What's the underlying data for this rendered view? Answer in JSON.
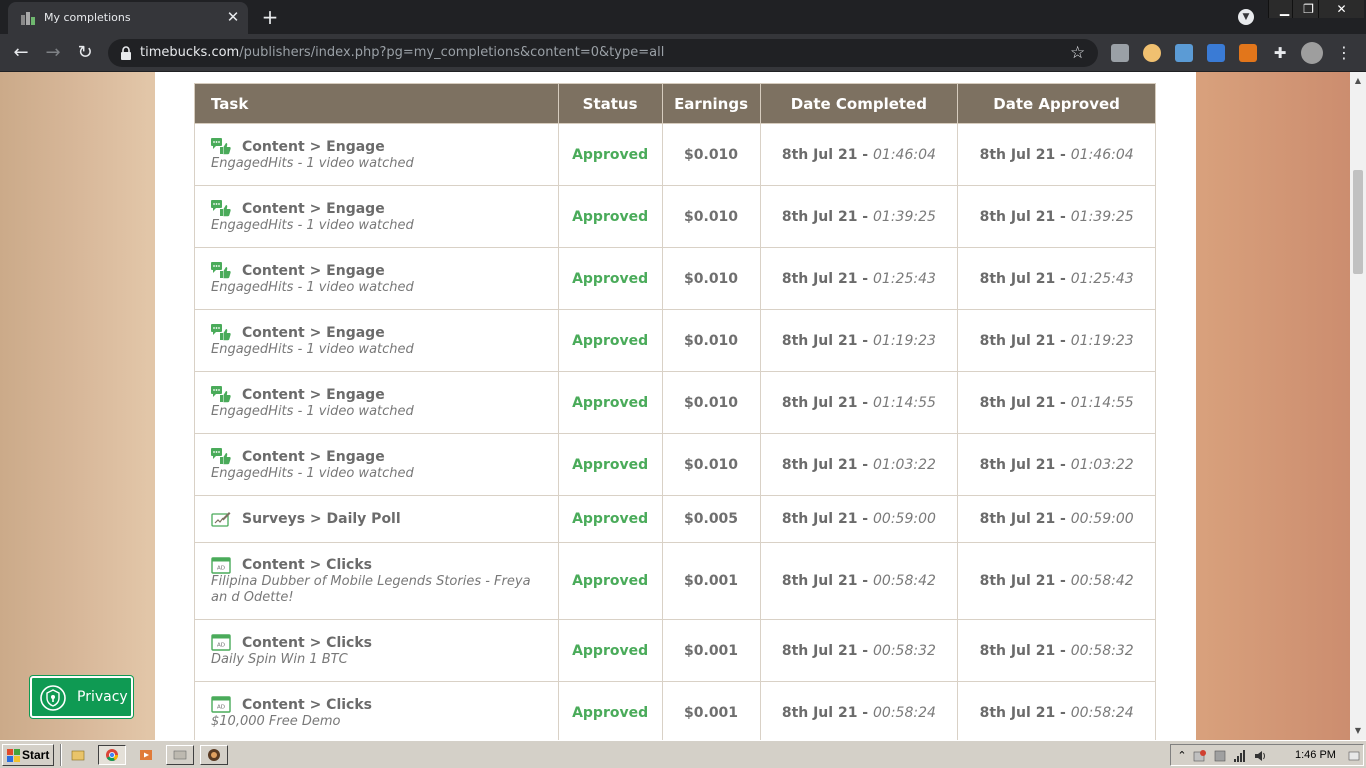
{
  "browser": {
    "tab_title": "My completions",
    "tab_close": "✕",
    "new_tab": "+",
    "url_host": "timebucks.com",
    "url_path": "/publishers/index.php?pg=my_completions&content=0&type=all"
  },
  "table": {
    "headers": {
      "task": "Task",
      "status": "Status",
      "earnings": "Earnings",
      "date_completed": "Date Completed",
      "date_approved": "Date Approved"
    },
    "rows": [
      {
        "icon": "engage-icon",
        "title": "Content > Engage",
        "subtitle": "EngagedHits - 1 video watched",
        "status": "Approved",
        "earnings": "$0.010",
        "completed_date": "8th Jul 21 - ",
        "completed_time": "01:46:04",
        "approved_date": "8th Jul 21 - ",
        "approved_time": "01:46:04"
      },
      {
        "icon": "engage-icon",
        "title": "Content > Engage",
        "subtitle": "EngagedHits - 1 video watched",
        "status": "Approved",
        "earnings": "$0.010",
        "completed_date": "8th Jul 21 - ",
        "completed_time": "01:39:25",
        "approved_date": "8th Jul 21 - ",
        "approved_time": "01:39:25"
      },
      {
        "icon": "engage-icon",
        "title": "Content > Engage",
        "subtitle": "EngagedHits - 1 video watched",
        "status": "Approved",
        "earnings": "$0.010",
        "completed_date": "8th Jul 21 - ",
        "completed_time": "01:25:43",
        "approved_date": "8th Jul 21 - ",
        "approved_time": "01:25:43"
      },
      {
        "icon": "engage-icon",
        "title": "Content > Engage",
        "subtitle": "EngagedHits - 1 video watched",
        "status": "Approved",
        "earnings": "$0.010",
        "completed_date": "8th Jul 21 - ",
        "completed_time": "01:19:23",
        "approved_date": "8th Jul 21 - ",
        "approved_time": "01:19:23"
      },
      {
        "icon": "engage-icon",
        "title": "Content > Engage",
        "subtitle": "EngagedHits - 1 video watched",
        "status": "Approved",
        "earnings": "$0.010",
        "completed_date": "8th Jul 21 - ",
        "completed_time": "01:14:55",
        "approved_date": "8th Jul 21 - ",
        "approved_time": "01:14:55"
      },
      {
        "icon": "engage-icon",
        "title": "Content > Engage",
        "subtitle": "EngagedHits - 1 video watched",
        "status": "Approved",
        "earnings": "$0.010",
        "completed_date": "8th Jul 21 - ",
        "completed_time": "01:03:22",
        "approved_date": "8th Jul 21 - ",
        "approved_time": "01:03:22"
      },
      {
        "icon": "poll-icon",
        "title": "Surveys > Daily Poll",
        "subtitle": "",
        "status": "Approved",
        "earnings": "$0.005",
        "completed_date": "8th Jul 21 - ",
        "completed_time": "00:59:00",
        "approved_date": "8th Jul 21 - ",
        "approved_time": "00:59:00"
      },
      {
        "icon": "ad-clicks-icon",
        "title": "Content > Clicks",
        "subtitle": "Filipina Dubber of Mobile Legends Stories - Freya an d Odette!",
        "status": "Approved",
        "earnings": "$0.001",
        "completed_date": "8th Jul 21 - ",
        "completed_time": "00:58:42",
        "approved_date": "8th Jul 21 - ",
        "approved_time": "00:58:42"
      },
      {
        "icon": "ad-clicks-icon",
        "title": "Content > Clicks",
        "subtitle": "Daily Spin Win 1 BTC",
        "status": "Approved",
        "earnings": "$0.001",
        "completed_date": "8th Jul 21 - ",
        "completed_time": "00:58:32",
        "approved_date": "8th Jul 21 - ",
        "approved_time": "00:58:32"
      },
      {
        "icon": "ad-clicks-icon",
        "title": "Content > Clicks",
        "subtitle": "$10,000 Free Demo",
        "status": "Approved",
        "earnings": "$0.001",
        "completed_date": "8th Jul 21 - ",
        "completed_time": "00:58:24",
        "approved_date": "8th Jul 21 - ",
        "approved_time": "00:58:24"
      }
    ]
  },
  "privacy": {
    "label": "Privacy"
  },
  "taskbar": {
    "start_label": "Start",
    "clock": "1:46 PM"
  },
  "colors": {
    "header_bg": "#7d7161",
    "status_green": "#4aab5a",
    "privacy_green": "#0f9a53"
  }
}
